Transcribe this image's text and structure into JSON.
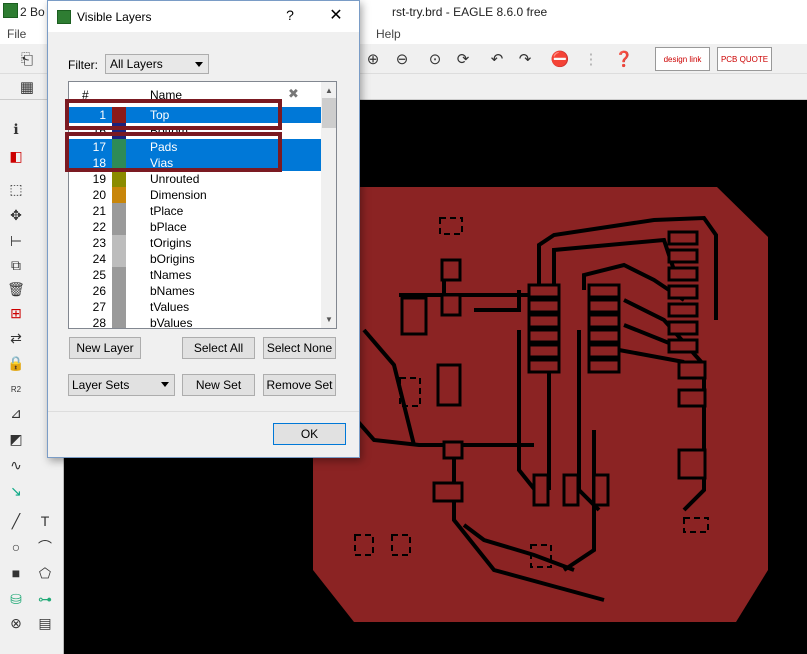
{
  "window": {
    "doc_tab": "2 Bo",
    "title": "rst-try.brd - EAGLE 8.6.0 free"
  },
  "menu": {
    "file": "File",
    "help": "Help"
  },
  "brand": {
    "design_link": "design link",
    "pcb_quote": "PCB QUOTE"
  },
  "dialog": {
    "title": "Visible Layers",
    "help": "?",
    "close": "✕",
    "filter_label": "Filter:",
    "filter_value": "All Layers",
    "col_num": "#",
    "col_name": "Name",
    "clear": "✖",
    "layers": [
      {
        "num": "1",
        "name": "Top",
        "color": "#8b1a1a",
        "selected": true
      },
      {
        "num": "16",
        "name": "Bottom",
        "color": "#1a237e",
        "selected": false
      },
      {
        "num": "17",
        "name": "Pads",
        "color": "#2e8b57",
        "selected": true
      },
      {
        "num": "18",
        "name": "Vias",
        "color": "#2e8b57",
        "selected": true
      },
      {
        "num": "19",
        "name": "Unrouted",
        "color": "#8b8b00",
        "selected": false
      },
      {
        "num": "20",
        "name": "Dimension",
        "color": "#c8860a",
        "selected": false
      },
      {
        "num": "21",
        "name": "tPlace",
        "color": "#9a9a9a",
        "selected": false
      },
      {
        "num": "22",
        "name": "bPlace",
        "color": "#9a9a9a",
        "selected": false
      },
      {
        "num": "23",
        "name": "tOrigins",
        "color": "#bdbdbd",
        "selected": false
      },
      {
        "num": "24",
        "name": "bOrigins",
        "color": "#bdbdbd",
        "selected": false
      },
      {
        "num": "25",
        "name": "tNames",
        "color": "#9a9a9a",
        "selected": false
      },
      {
        "num": "26",
        "name": "bNames",
        "color": "#9a9a9a",
        "selected": false
      },
      {
        "num": "27",
        "name": "tValues",
        "color": "#9a9a9a",
        "selected": false
      },
      {
        "num": "28",
        "name": "bValues",
        "color": "#9a9a9a",
        "selected": false
      }
    ],
    "new_layer": "New Layer",
    "select_all": "Select All",
    "select_none": "Select None",
    "layer_sets": "Layer Sets",
    "new_set": "New Set",
    "remove_set": "Remove Set",
    "ok": "OK"
  },
  "colors": {
    "board": "#8b2323",
    "selection": "#0078d7",
    "highlight_box": "#7b1a22"
  }
}
